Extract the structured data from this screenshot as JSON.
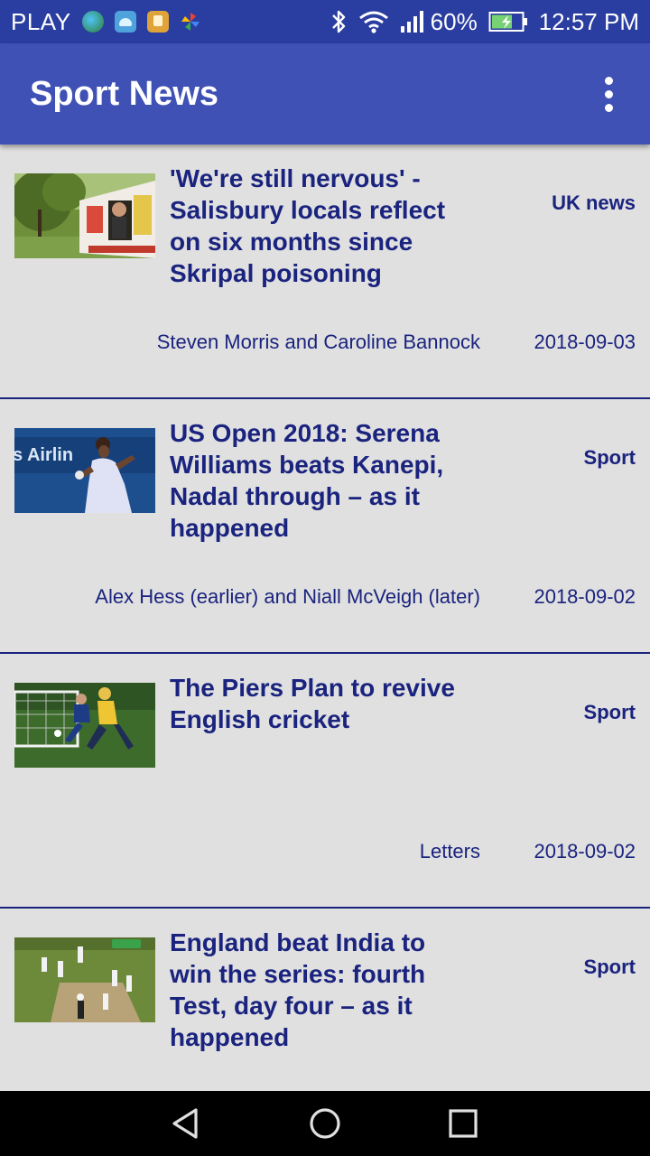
{
  "status_bar": {
    "carrier": "PLAY",
    "battery_percent": "60%",
    "time": "12:57 PM"
  },
  "app_bar": {
    "title": "Sport News"
  },
  "colors": {
    "status_bar": "#2a3da0",
    "app_bar": "#3f51b5",
    "text": "#1a237e",
    "background": "#e0e0e0"
  },
  "articles": [
    {
      "headline": "'We're still nervous' - Salisbury locals reflect on six months since Skripal poisoning",
      "section": "UK news",
      "byline": "Steven Morris and Caroline Bannock",
      "date": "2018-09-03"
    },
    {
      "headline": "US Open 2018: Serena Williams beats Kanepi, Nadal through – as it happened",
      "section": "Sport",
      "byline": "Alex Hess (earlier) and Niall McVeigh (later)",
      "date": "2018-09-02"
    },
    {
      "headline": "The Piers Plan to revive English cricket",
      "section": "Sport",
      "byline": "Letters",
      "date": "2018-09-02"
    },
    {
      "headline": "England beat India to win the series: fourth Test, day four – as it happened",
      "section": "Sport",
      "byline": "",
      "date": ""
    }
  ],
  "thumbnail_texts": {
    "airlines_banner": "s Airlin"
  }
}
